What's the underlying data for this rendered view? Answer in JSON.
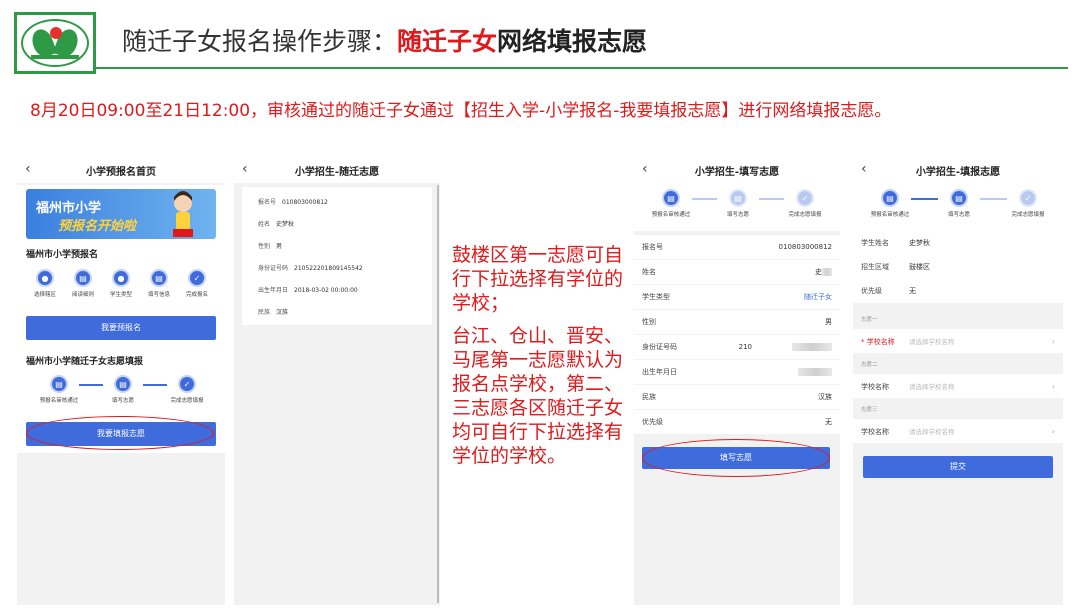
{
  "header": {
    "title_prefix": "随迁子女报名操作步骤：",
    "title_red": "随迁子女",
    "title_rest": "网络填报志愿"
  },
  "notice": "8月20日09:00至21日12:00，审核通过的随迁子女通过【招生入学-小学报名-我要填报志愿】进行网络填报志愿。",
  "panel1": {
    "title": "小学预报名首页",
    "banner_line1": "福州市小学",
    "banner_line2": "预报名开始啦",
    "section1_title": "福州市小学预报名",
    "steps1": [
      "选择辖区",
      "阅读细则",
      "学生类型",
      "填写信息",
      "完成报名"
    ],
    "btn1": "我要预报名",
    "section2_title": "福州市小学随迁子女志愿填报",
    "steps2": [
      "预报名审核通过",
      "填写志愿",
      "完成志愿填报"
    ],
    "btn2": "我要填报志愿"
  },
  "panel2": {
    "title": "小学招生-随迁志愿",
    "rows": [
      {
        "label": "报名号",
        "value": "010803000812"
      },
      {
        "label": "姓名",
        "value": "史梦秋"
      },
      {
        "label": "性别",
        "value": "男"
      },
      {
        "label": "身份证号码",
        "value": "210522201809145542"
      },
      {
        "label": "出生年月日",
        "value": "2018-03-02 00:00:00"
      },
      {
        "label": "民族",
        "value": "汉族"
      }
    ]
  },
  "middle_text": {
    "para1": "鼓楼区第一志愿可自行下拉选择有学位的学校；",
    "para2": "台江、仓山、晋安、马尾第一志愿默认为报名点学校，第二、三志愿各区随迁子女均可自行下拉选择有学位的学校。"
  },
  "panel3": {
    "title": "小学招生-填写志愿",
    "steps": [
      "预报名审核通过",
      "填写志愿",
      "完成志愿填报"
    ],
    "rows": [
      {
        "label": "报名号",
        "value": "010803000812"
      },
      {
        "label": "姓名",
        "value": "史"
      },
      {
        "label": "学生类型",
        "value": "随迁子女"
      },
      {
        "label": "性别",
        "value": "男"
      },
      {
        "label": "身份证号码",
        "value": "210"
      },
      {
        "label": "出生年月日",
        "value": ""
      },
      {
        "label": "民族",
        "value": "汉族"
      },
      {
        "label": "优先级",
        "value": "无"
      }
    ],
    "button": "填写志愿"
  },
  "panel4": {
    "title": "小学招生-填报志愿",
    "steps": [
      "预报名审核通过",
      "填写志愿",
      "完成志愿填报"
    ],
    "rows": [
      {
        "label": "学生姓名",
        "value": "史梦秋"
      },
      {
        "label": "招生区域",
        "value": "鼓楼区"
      },
      {
        "label": "优先级",
        "value": "无"
      }
    ],
    "groups": [
      "志愿一",
      "志愿二",
      "志愿三"
    ],
    "school_label": "学校名称",
    "school_required_label": "* 学校名称",
    "school_placeholder": "请选择学校名称",
    "submit": "提交"
  },
  "colors": {
    "accent_blue": "#3f6bdc",
    "red": "#e0191b",
    "brand_green": "#2f9a45"
  },
  "icons": {
    "back": "chevron-left-icon",
    "more": "chevron-right-icon"
  }
}
